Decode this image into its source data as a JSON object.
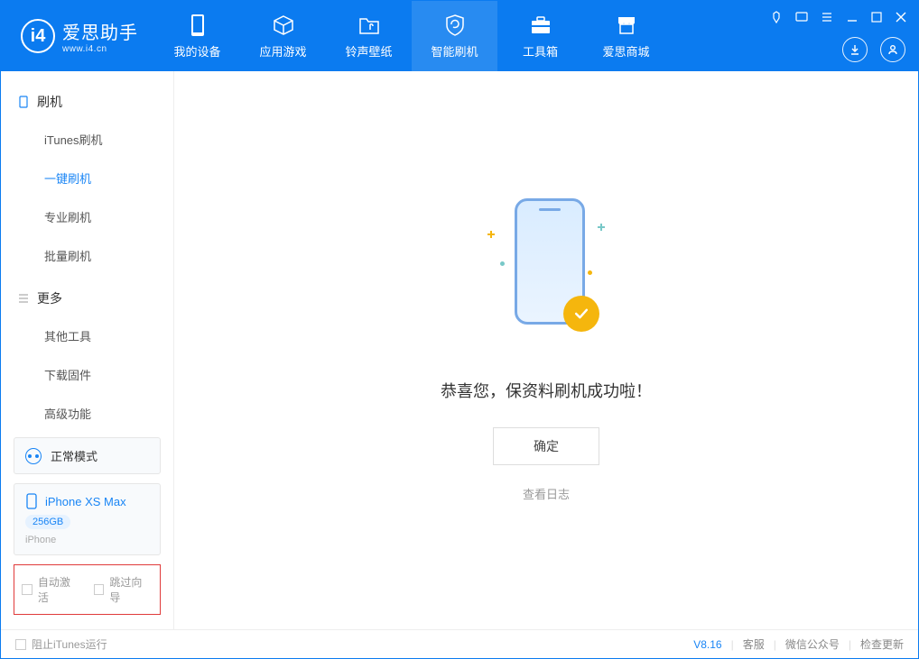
{
  "app": {
    "name": "爱思助手",
    "domain": "www.i4.cn"
  },
  "tabs": {
    "device": "我的设备",
    "apps": "应用游戏",
    "ringtone": "铃声壁纸",
    "flash": "智能刷机",
    "toolbox": "工具箱",
    "store": "爱思商城"
  },
  "sidebar": {
    "group_flash": "刷机",
    "itunes_flash": "iTunes刷机",
    "one_key_flash": "一键刷机",
    "pro_flash": "专业刷机",
    "batch_flash": "批量刷机",
    "group_more": "更多",
    "other_tools": "其他工具",
    "download_fw": "下载固件",
    "advanced": "高级功能"
  },
  "mode": {
    "label": "正常模式"
  },
  "device": {
    "name": "iPhone XS Max",
    "capacity": "256GB",
    "type": "iPhone"
  },
  "options": {
    "auto_activate": "自动激活",
    "skip_guide": "跳过向导"
  },
  "main": {
    "success": "恭喜您，保资料刷机成功啦！",
    "ok": "确定",
    "view_log": "查看日志"
  },
  "footer": {
    "block_itunes": "阻止iTunes运行",
    "version": "V8.16",
    "cs": "客服",
    "wechat": "微信公众号",
    "update": "检查更新"
  }
}
